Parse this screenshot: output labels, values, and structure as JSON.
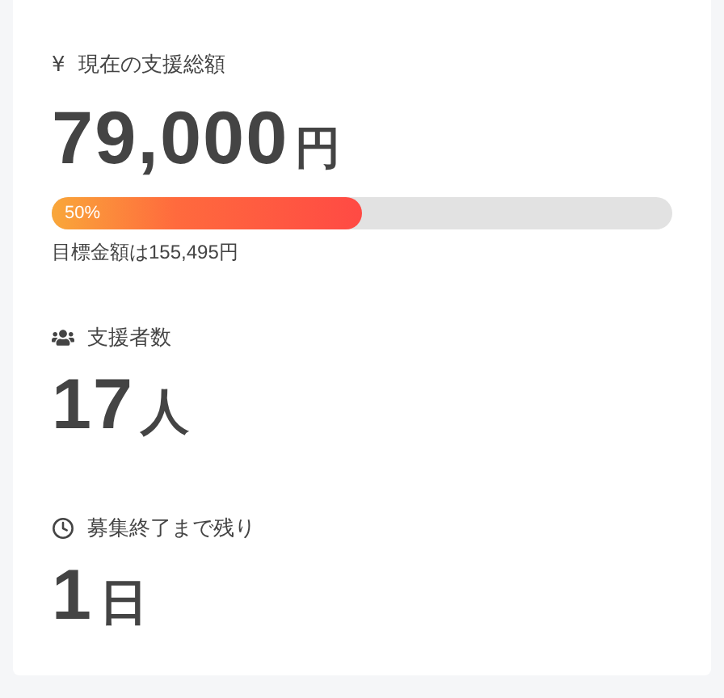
{
  "stats": [
    {
      "kind": "amount",
      "icon_text": "¥",
      "label": "現在の支援総額",
      "value": "79,000",
      "unit": "円",
      "progress": {
        "level": 0.5,
        "label": "50%"
      },
      "note": "目標金額は155,495円"
    },
    {
      "kind": "supporters",
      "label": "支援者数",
      "value": "17",
      "unit": "人"
    },
    {
      "kind": "remaining",
      "label": "募集終了まで残り",
      "value": "1",
      "unit": "日"
    }
  ]
}
